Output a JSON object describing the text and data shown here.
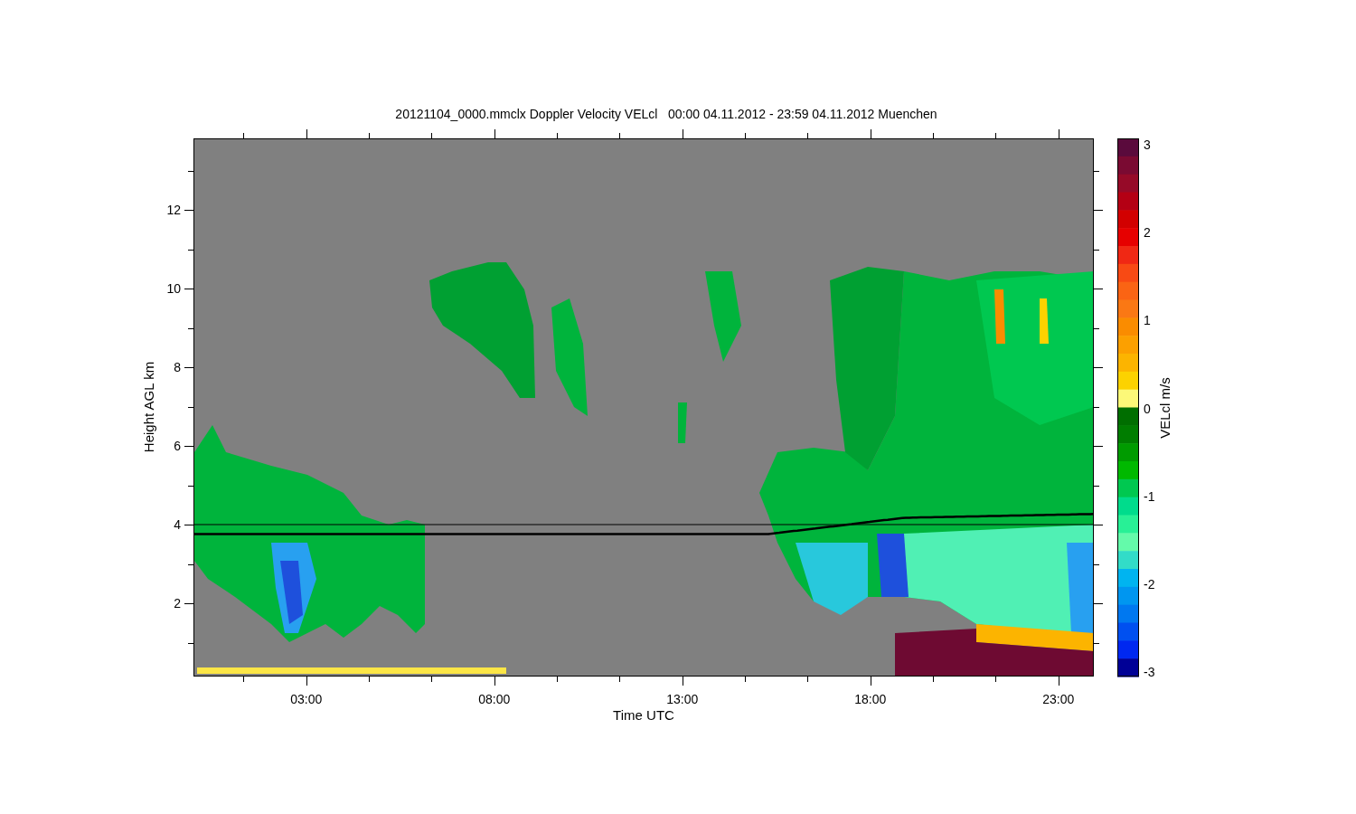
{
  "title": "20121104_0000.mmclx Doppler Velocity VELcl   00:00 04.11.2012 - 23:59 04.11.2012 Muenchen",
  "y_axis": {
    "label": "Height AGL km",
    "ticks": [
      "12",
      "10",
      "8",
      "6",
      "4",
      "2"
    ]
  },
  "x_axis": {
    "label": "Time UTC",
    "ticks": [
      "03:00",
      "08:00",
      "13:00",
      "18:00",
      "23:00"
    ]
  },
  "colorbar": {
    "label": "VELcl m/s",
    "ticks": [
      "3",
      "2",
      "1",
      "0",
      "-1",
      "-2",
      "-3"
    ]
  }
}
